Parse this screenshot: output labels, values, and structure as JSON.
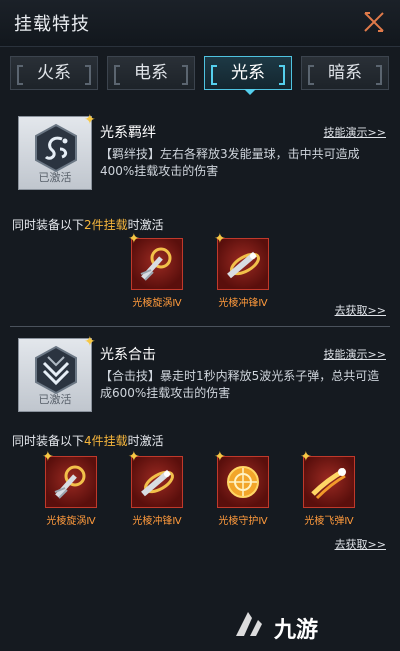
{
  "header": {
    "title": "挂载特技"
  },
  "tabs": [
    {
      "label": "火系",
      "active": false
    },
    {
      "label": "电系",
      "active": false
    },
    {
      "label": "光系",
      "active": true
    },
    {
      "label": "暗系",
      "active": false
    }
  ],
  "sections": [
    {
      "skill_name": "光系羁绊",
      "status": "已激活",
      "demo_link": "技能演示>>",
      "description": "【羁绊技】左右各释放3发能量球，击中共可造成400%挂载攻击的伤害",
      "requirement": {
        "prefix": "同时装备以下",
        "highlight": "2件挂载",
        "suffix": "时激活"
      },
      "items": [
        {
          "name": "光棱旋涡Ⅳ",
          "icon": "spiral-weapon-icon"
        },
        {
          "name": "光棱冲锋Ⅳ",
          "icon": "charge-weapon-icon"
        }
      ],
      "get_link": "去获取>>"
    },
    {
      "skill_name": "光系合击",
      "status": "已激活",
      "demo_link": "技能演示>>",
      "description": "【合击技】暴走时1秒内释放5波光系子弹，总共可造成600%挂载攻击的伤害",
      "requirement": {
        "prefix": "同时装备以下",
        "highlight": "4件挂载",
        "suffix": "时激活"
      },
      "items": [
        {
          "name": "光棱旋涡Ⅳ",
          "icon": "spiral-weapon-icon"
        },
        {
          "name": "光棱冲锋Ⅳ",
          "icon": "charge-weapon-icon"
        },
        {
          "name": "光棱守护Ⅳ",
          "icon": "shield-orb-icon"
        },
        {
          "name": "光棱飞弹Ⅳ",
          "icon": "missile-icon"
        }
      ],
      "get_link": "去获取>>"
    }
  ],
  "watermark": {
    "text": "九游"
  },
  "colors": {
    "accent": "#55d0ee",
    "highlight": "#f5b53c",
    "item_name": "#ff9a3c",
    "item_bg": "#7a1a14"
  }
}
